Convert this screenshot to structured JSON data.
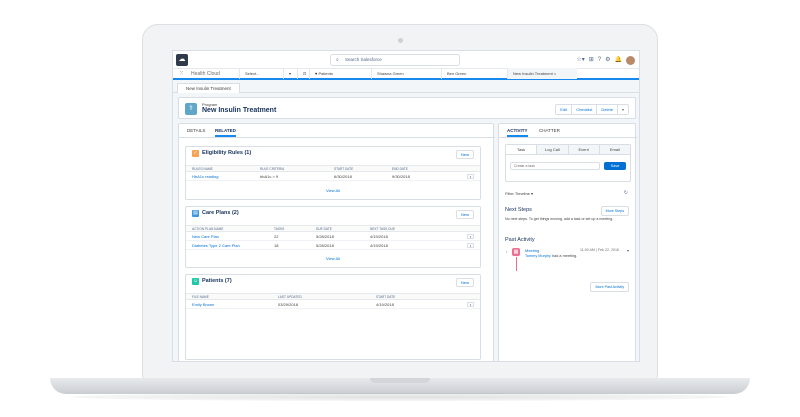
{
  "topbar": {
    "search_placeholder": "Search Salesforce",
    "icons": [
      "star-icon",
      "add-icon",
      "help-icon",
      "gear-icon",
      "bell-icon",
      "avatar"
    ]
  },
  "nav": {
    "app_name": "Health Cloud",
    "tabs": [
      {
        "label": "Select..."
      },
      {
        "label": "♥ Patients"
      },
      {
        "label": "Shawna Green"
      },
      {
        "label": "Ben Green"
      },
      {
        "label": "New Insulin Treatment  ×"
      }
    ]
  },
  "subtab": {
    "label": "New Insulin Treatment"
  },
  "record": {
    "type": "Program",
    "title": "New Insulin Treatment",
    "actions": [
      "Edit",
      "Checklist",
      "Delete",
      "▾"
    ]
  },
  "left_tabs": [
    "DETAILS",
    "RELATED"
  ],
  "eligibility": {
    "title": "Eligibility Rules (1)",
    "new_label": "New",
    "columns": [
      "RULES NAME",
      "RULE CRITERIA",
      "START DATE",
      "END DATE"
    ],
    "rows": [
      [
        "HbA1c reading",
        "hbA1c > 9",
        "6/30/2018",
        "9/30/2018"
      ]
    ],
    "view_all": "View All"
  },
  "care_plans": {
    "title": "Care Plans (2)",
    "new_label": "New",
    "columns": [
      "ACTION PLAN NAME",
      "TASKS",
      "DUE DATE",
      "NEXT TASK DUE"
    ],
    "rows": [
      [
        "New Care Plan",
        "22",
        "5/28/2018",
        "4/19/2018"
      ],
      [
        "Diabetes Type 2 Care Plan",
        "18",
        "5/28/2018",
        "4/19/2018"
      ]
    ],
    "view_all": "View All"
  },
  "patients": {
    "title": "Patients (7)",
    "new_label": "New",
    "columns": [
      "FILE NAME",
      "LAST UPDATED",
      "START DATE"
    ],
    "rows": [
      [
        "Emily Brown",
        "03/29/2018",
        "4/19/2018"
      ]
    ]
  },
  "right_tabs": [
    "ACTIVITY",
    "CHATTER"
  ],
  "composer": {
    "tabs": [
      "Task",
      "Log Call",
      "Event",
      "Email"
    ],
    "placeholder": "Create a task",
    "save_label": "Save"
  },
  "timeline": {
    "filter_label": "Filter Timeline ▾",
    "next_steps_title": "Next Steps",
    "more_steps_label": "More Steps",
    "next_steps_text": "No next steps. To get things moving, add a task or set up a meeting.",
    "past_title": "Past Activity",
    "activity": {
      "subject": "Meeting",
      "time": "11:00 AM | Feb 22, 2016",
      "who": "Tommy Murphy",
      "action": " had a meeting."
    },
    "more_past_label": "More Past Activity"
  },
  "colors": {
    "accent": "#1589ee",
    "link": "#0070d2",
    "eligibility_icon": "#f7a452",
    "care_plan_icon": "#3c97dd",
    "patients_icon": "#1fc9a8",
    "meeting_icon": "#eb7092"
  }
}
